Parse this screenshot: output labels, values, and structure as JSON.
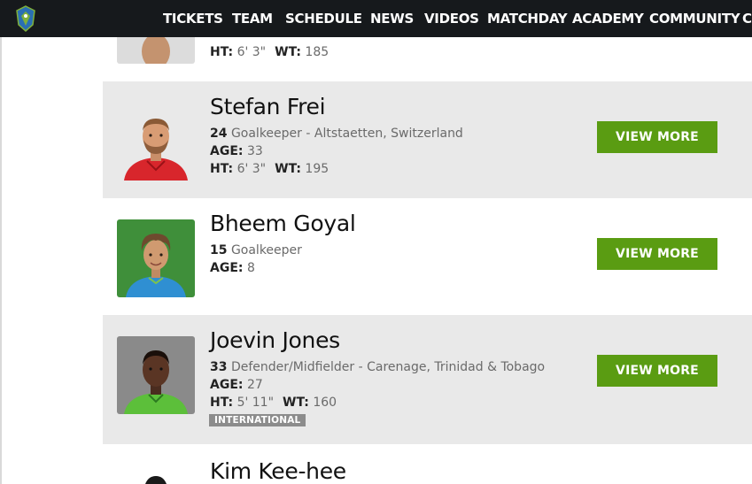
{
  "nav": {
    "items": [
      "TICKETS",
      "TEAM",
      "SCHEDULE",
      "NEWS",
      "VIDEOS",
      "MATCHDAY",
      "ACADEMY",
      "COMMUNITY",
      "CA"
    ]
  },
  "partial_top": {
    "ht_label": "HT:",
    "ht": "6' 3\"",
    "wt_label": "WT:",
    "wt": "185"
  },
  "players": [
    {
      "name": "Stefan Frei",
      "number": "24",
      "position": "Goalkeeper - Altstaetten, Switzerland",
      "age_label": "AGE:",
      "age": "33",
      "ht_label": "HT:",
      "ht": "6' 3\"",
      "wt_label": "WT:",
      "wt": "195",
      "button": "VIEW MORE"
    },
    {
      "name": "Bheem Goyal",
      "number": "15",
      "position": "Goalkeeper",
      "age_label": "AGE:",
      "age": "8",
      "button": "VIEW MORE"
    },
    {
      "name": "Joevin Jones",
      "number": "33",
      "position": "Defender/Midfielder - Carenage, Trinidad & Tobago",
      "age_label": "AGE:",
      "age": "27",
      "ht_label": "HT:",
      "ht": "5' 11\"",
      "wt_label": "WT:",
      "wt": "160",
      "badge": "INTERNATIONAL",
      "button": "VIEW MORE"
    }
  ],
  "partial_bottom": {
    "name": "Kim Kee-hee"
  },
  "colors": {
    "nav_bg": "#16191c",
    "card_shade": "#e9e9e9",
    "button": "#5a9c12",
    "badge": "#8c8c8c"
  }
}
